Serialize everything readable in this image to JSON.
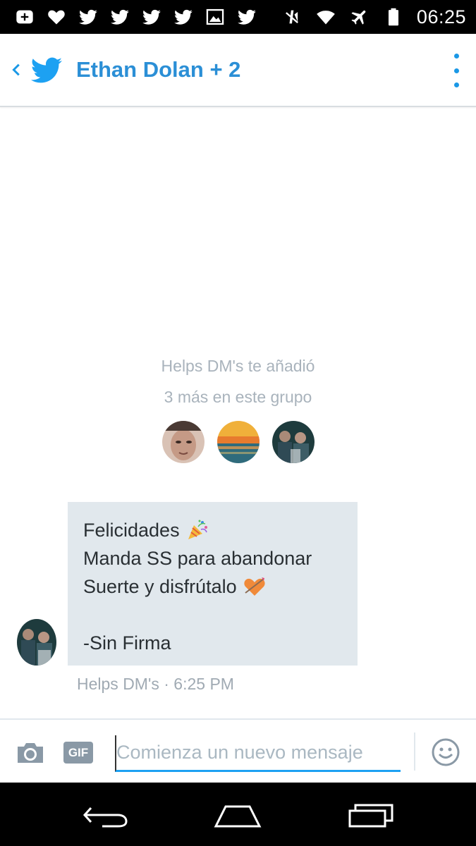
{
  "status_bar": {
    "time": "06:25",
    "left_icons": [
      "add-box-icon",
      "heart-icon",
      "twitter-bird-icon",
      "twitter-bird-icon",
      "twitter-bird-icon",
      "twitter-bird-icon",
      "image-icon",
      "twitter-bird-icon"
    ],
    "right_icons": [
      "mute-icon",
      "wifi-icon",
      "airplane-icon",
      "battery-icon"
    ]
  },
  "header": {
    "title": "Ethan Dolan + 2",
    "accent_color": "#1da1f2"
  },
  "conversation": {
    "added_by": "Helps DM's te añadió",
    "members_note": "3 más en este grupo",
    "member_avatars": [
      "avatar-girl",
      "avatar-sunset",
      "avatar-group"
    ]
  },
  "message": {
    "lines": [
      "Felicidades",
      "Manda SS para abandonar",
      "Suerte y disfrútalo",
      "",
      "-Sin Firma"
    ],
    "line_emojis": [
      "party-popper-icon",
      "",
      "orange-heart-arrow-icon",
      "",
      ""
    ],
    "meta": "Helps DM's · 6:25 PM"
  },
  "composer": {
    "gif_label": "GIF",
    "placeholder": "Comienza un nuevo mensaje"
  },
  "nav_bar": {
    "buttons": [
      "back-nav-icon",
      "home-nav-icon",
      "recents-nav-icon"
    ]
  }
}
